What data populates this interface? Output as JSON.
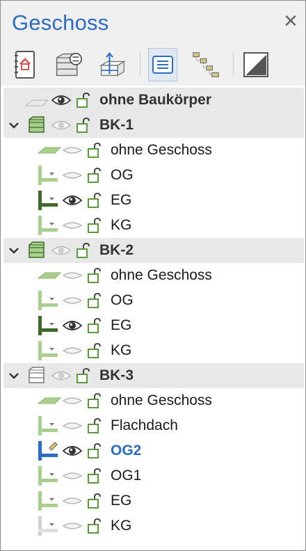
{
  "panel": {
    "title": "Geschoss",
    "close_icon": "close-icon"
  },
  "toolbar": {
    "buttons": [
      {
        "name": "building-properties-icon"
      },
      {
        "name": "storey-settings-icon"
      },
      {
        "name": "storey-height-icon"
      },
      {
        "name": "list-view-icon",
        "active": true
      },
      {
        "name": "hierarchy-view-icon"
      },
      {
        "name": "toggle-view-icon"
      }
    ]
  },
  "tree": {
    "root": {
      "label": "ohne Baukörper"
    },
    "groups": [
      {
        "label": "BK-1",
        "items": [
          {
            "label": "ohne Geschoss",
            "kind": "slab",
            "visible": false
          },
          {
            "label": "OG",
            "kind": "floor",
            "visible": false
          },
          {
            "label": "EG",
            "kind": "floor-current",
            "visible": true
          },
          {
            "label": "KG",
            "kind": "floor",
            "visible": false
          }
        ]
      },
      {
        "label": "BK-2",
        "items": [
          {
            "label": "ohne Geschoss",
            "kind": "slab",
            "visible": false
          },
          {
            "label": "OG",
            "kind": "floor",
            "visible": false
          },
          {
            "label": "EG",
            "kind": "floor-current",
            "visible": true
          },
          {
            "label": "KG",
            "kind": "floor",
            "visible": false
          }
        ]
      },
      {
        "label": "BK-3",
        "items": [
          {
            "label": "ohne Geschoss",
            "kind": "slab",
            "visible": false
          },
          {
            "label": "Flachdach",
            "kind": "floor",
            "visible": false
          },
          {
            "label": "OG2",
            "kind": "floor-active",
            "visible": true,
            "active": true
          },
          {
            "label": "OG1",
            "kind": "floor",
            "visible": false
          },
          {
            "label": "EG",
            "kind": "floor",
            "visible": false
          },
          {
            "label": "KG",
            "kind": "floor-light",
            "visible": false
          }
        ]
      }
    ]
  },
  "colors": {
    "accent": "#2b6cc4",
    "floor_green": "#a9cf8e",
    "floor_dark": "#3f6b2a",
    "lock_green": "#5b9a3c"
  }
}
